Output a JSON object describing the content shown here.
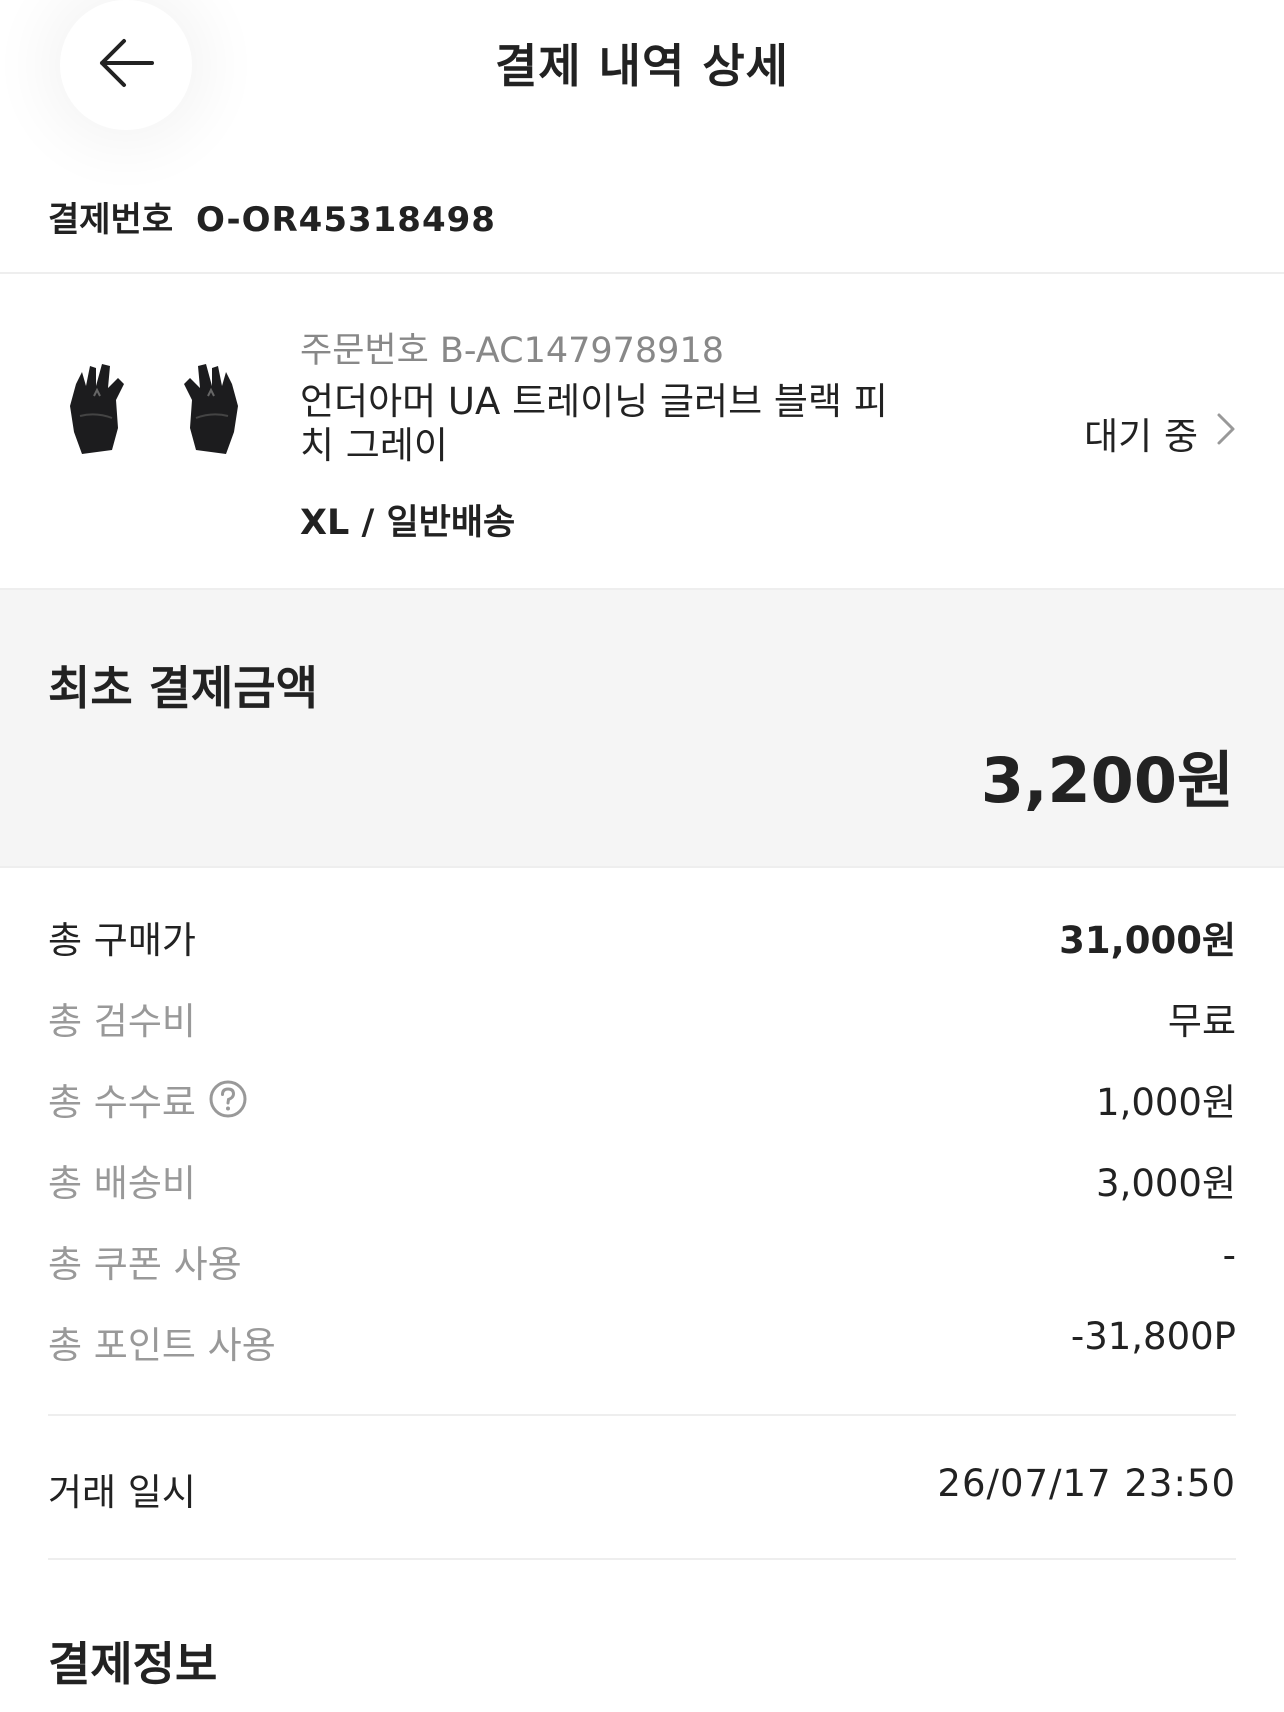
{
  "header": {
    "title": "결제 내역 상세",
    "back_icon": "arrow-left-icon"
  },
  "payment": {
    "label": "결제번호",
    "number": "O-OR45318498"
  },
  "product": {
    "order_no": "주문번호 B-AC147978918",
    "name": "언더아머 UA 트레이닝 글러브 블랙 피치 그레이",
    "option": "XL / 일반배송",
    "status": "대기 중",
    "status_icon": "chevron-right-icon",
    "image": "gloves-thumbnail"
  },
  "total": {
    "label": "최초 결제금액",
    "amount": "3,200원"
  },
  "breakdown": [
    {
      "label": "총 구매가",
      "value": "31,000원"
    },
    {
      "label": "총 검수비",
      "value": "무료"
    },
    {
      "label": "총 수수료",
      "value": "1,000원",
      "icon": "question-circle-icon"
    },
    {
      "label": "총 배송비",
      "value": "3,000원"
    },
    {
      "label": "총 쿠폰 사용",
      "value": "-"
    },
    {
      "label": "총 포인트 사용",
      "value": "-31,800P"
    }
  ],
  "transaction": {
    "label": "거래 일시",
    "datetime": "26/07/17 23:50"
  },
  "payment_info": {
    "title": "결제정보"
  },
  "colors": {
    "text": "#222222",
    "muted": "#999999",
    "order_no": "#888888",
    "total_bg": "#f5f5f5",
    "divider": "#eeeeee"
  }
}
